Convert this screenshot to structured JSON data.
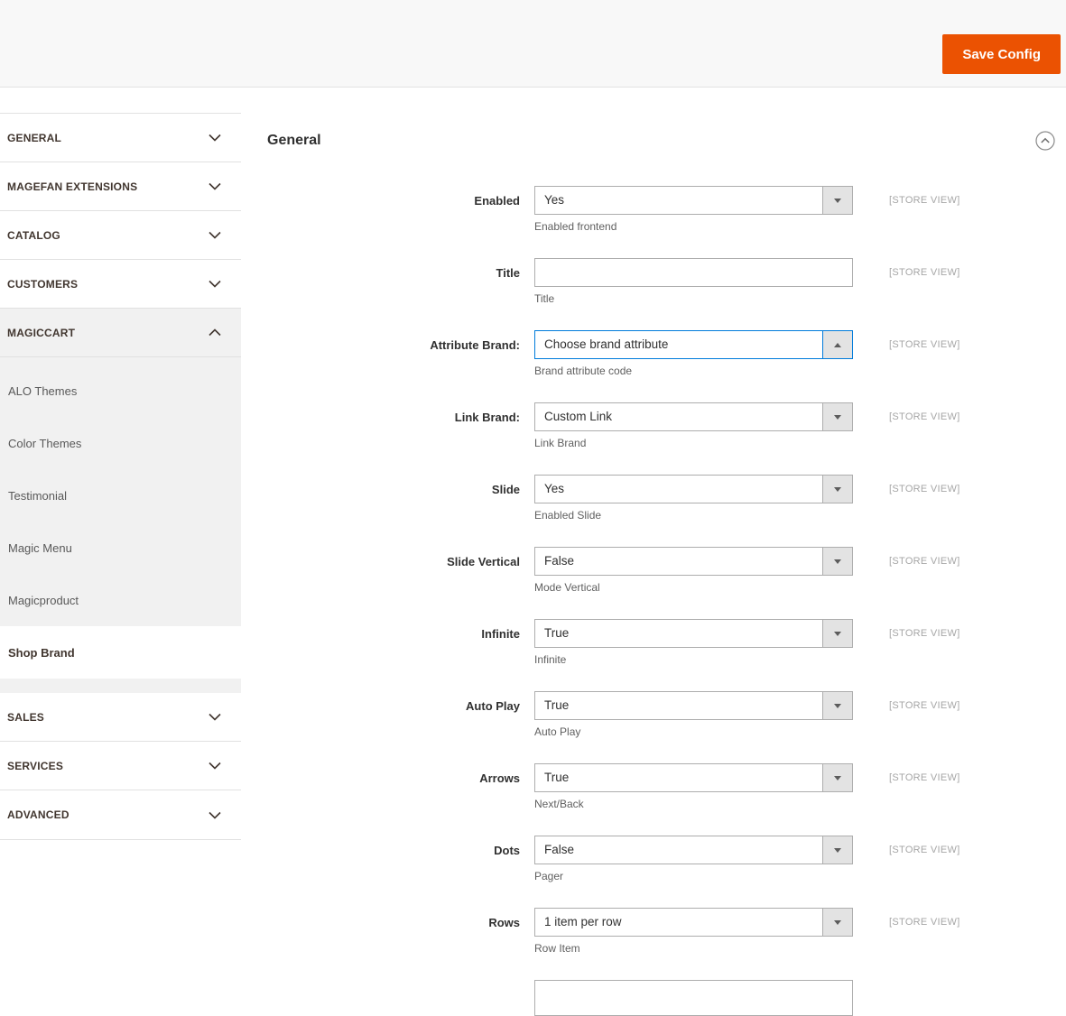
{
  "header": {
    "save_button_label": "Save Config"
  },
  "sidebar": {
    "top_sections": [
      {
        "label": "GENERAL"
      },
      {
        "label": "MAGEFAN EXTENSIONS"
      },
      {
        "label": "CATALOG"
      },
      {
        "label": "CUSTOMERS"
      }
    ],
    "expanded_section": {
      "label": "MAGICCART"
    },
    "subitems": [
      {
        "label": "ALO Themes"
      },
      {
        "label": "Color Themes"
      },
      {
        "label": "Testimonial"
      },
      {
        "label": "Magic Menu"
      },
      {
        "label": "Magicproduct"
      },
      {
        "label": "Shop Brand",
        "active": true
      }
    ],
    "bottom_sections": [
      {
        "label": "SALES"
      },
      {
        "label": "SERVICES"
      },
      {
        "label": "ADVANCED"
      }
    ]
  },
  "main": {
    "section_title": "General",
    "scope_label": "[STORE VIEW]",
    "fields": [
      {
        "label": "Enabled",
        "value": "Yes",
        "note": "Enabled frontend"
      },
      {
        "label": "Title",
        "value": "",
        "note": "Title"
      },
      {
        "label": "Attribute Brand:",
        "value": "Choose brand attribute",
        "note": "Brand attribute code"
      },
      {
        "label": "Link Brand:",
        "value": "Custom Link",
        "note": "Link Brand"
      },
      {
        "label": "Slide",
        "value": "Yes",
        "note": "Enabled Slide"
      },
      {
        "label": "Slide Vertical",
        "value": "False",
        "note": "Mode Vertical"
      },
      {
        "label": "Infinite",
        "value": "True",
        "note": "Infinite"
      },
      {
        "label": "Auto Play",
        "value": "True",
        "note": "Auto Play"
      },
      {
        "label": "Arrows",
        "value": "True",
        "note": "Next/Back"
      },
      {
        "label": "Dots",
        "value": "False",
        "note": "Pager"
      },
      {
        "label": "Rows",
        "value": "1 item per row",
        "note": "Row Item"
      }
    ],
    "colors": {
      "accent_orange": "#eb5202",
      "focus_blue": "#007bdb",
      "header_bg": "#f8f8f8",
      "expanded_nav_bg": "#f1f1f1"
    }
  }
}
